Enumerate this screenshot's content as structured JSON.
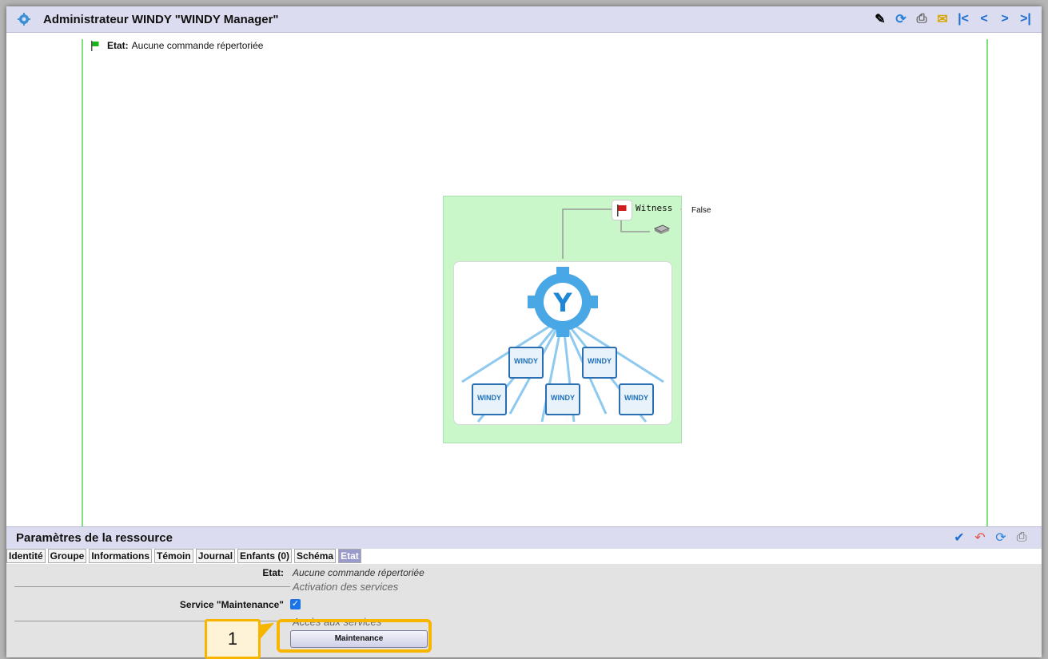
{
  "window": {
    "title": "Administrateur WINDY \"WINDY Manager\"",
    "toolbar_icons": [
      "edit-icon",
      "refresh-icon",
      "print-icon",
      "export-icon",
      "first-icon",
      "previous-icon",
      "next-icon",
      "last-icon"
    ]
  },
  "main": {
    "state_label": "Etat:",
    "state_value": "Aucune commande répertoriée"
  },
  "diagram": {
    "witness_label": "Witness",
    "witness_value": "False",
    "device_labels": [
      "WINDY",
      "WINDY",
      "WINDY",
      "WINDY",
      "WINDY"
    ]
  },
  "params": {
    "title": "Paramètres de la ressource",
    "icons": [
      "validate-icon",
      "undo-icon",
      "refresh-icon",
      "print-icon"
    ],
    "tabs": [
      {
        "label": "Identité",
        "active": false
      },
      {
        "label": "Groupe",
        "active": false
      },
      {
        "label": "Informations",
        "active": false
      },
      {
        "label": "Témoin",
        "active": false
      },
      {
        "label": "Journal",
        "active": false
      },
      {
        "label": "Enfants (0)",
        "active": false
      },
      {
        "label": "Schéma",
        "active": false
      },
      {
        "label": "Etat",
        "active": true
      }
    ],
    "etat_label": "Etat:",
    "etat_value": "Aucune commande répertoriée",
    "section_activation": "Activation des services",
    "service_label": "Service \"Maintenance\"",
    "service_checked": true,
    "section_access": "Accès aux services",
    "maintenance_button": "Maintenance"
  },
  "annotation": {
    "callout_number": "1",
    "color": "#f7b500"
  }
}
